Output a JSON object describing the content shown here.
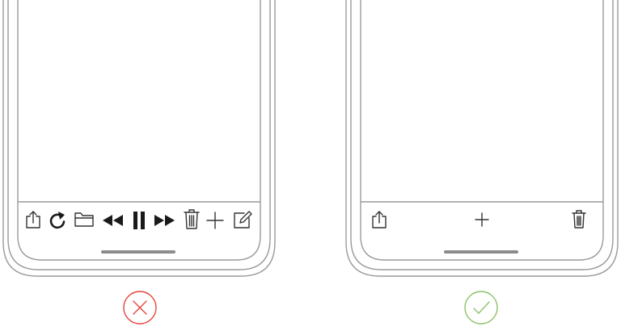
{
  "colors": {
    "outline": "#9a9a9a",
    "icon": "#333333",
    "home_indicator": "#8c8c8c",
    "incorrect": "#e8453c",
    "correct": "#8dc26a"
  },
  "examples": [
    {
      "verdict": "incorrect",
      "verdict_icon": "x-circle-icon",
      "toolbar_icons": [
        "share-icon",
        "refresh-icon",
        "folder-icon",
        "rewind-icon",
        "pause-icon",
        "fast-forward-icon",
        "trash-icon",
        "plus-icon",
        "compose-icon"
      ]
    },
    {
      "verdict": "correct",
      "verdict_icon": "checkmark-circle-icon",
      "toolbar_icons": [
        "share-icon",
        "plus-icon",
        "trash-icon"
      ]
    }
  ]
}
